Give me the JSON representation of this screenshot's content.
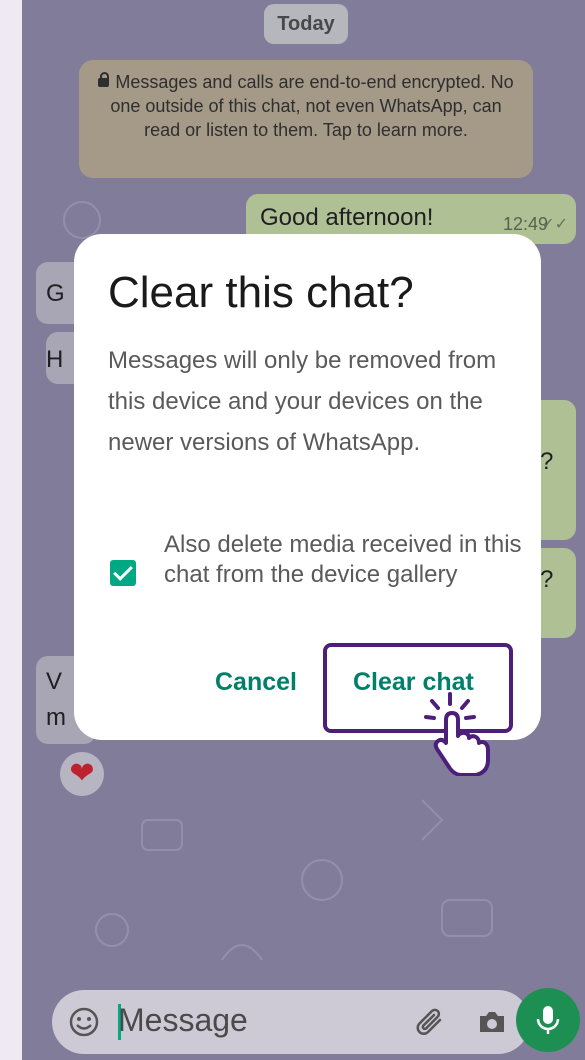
{
  "chat": {
    "date_chip": "Today",
    "encryption_notice": "Messages and calls are end-to-end encrypted. No one outside of this chat, not even WhatsApp, can read or listen to them. Tap to learn more.",
    "messages": [
      {
        "text": "Good afternoon!",
        "time": "12:49",
        "ticks": "✓✓"
      }
    ],
    "partial_incoming": [
      "G",
      "H",
      "V",
      "m"
    ],
    "partial_outgoing": [
      "?",
      "?"
    ],
    "reaction": "❤"
  },
  "dialog": {
    "title": "Clear this chat?",
    "body": "Messages will only be removed from this device and your devices on the newer versions of WhatsApp.",
    "checkbox_label": "Also delete media received in this chat from the device gallery",
    "checkbox_checked": true,
    "cancel_label": "Cancel",
    "confirm_label": "Clear chat"
  },
  "composer": {
    "placeholder": "Message",
    "icons": [
      "emoji-icon",
      "attach-icon",
      "camera-icon",
      "mic-icon"
    ]
  },
  "colors": {
    "accent": "#008069",
    "checkbox": "#00a884",
    "highlight": "#4b1f7a",
    "mic_button": "#1e8f52"
  }
}
